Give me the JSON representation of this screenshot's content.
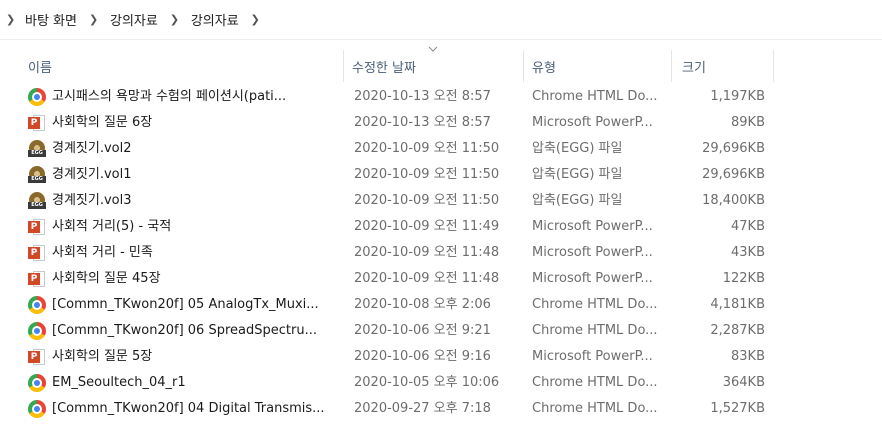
{
  "breadcrumb": {
    "items": [
      "바탕 화면",
      "강의자료",
      "강의자료"
    ]
  },
  "columns": {
    "name": "이름",
    "date": "수정한 날짜",
    "type": "유형",
    "size": "크기"
  },
  "files": [
    {
      "icon": "chrome-icon",
      "name": "고시패스의 욕망과 수험의 페이션시(pati...",
      "date": "2020-10-13 오전 8:57",
      "type": "Chrome HTML Do...",
      "size": "1,197KB"
    },
    {
      "icon": "powerpoint-icon",
      "name": "사회학의 질문 6장",
      "date": "2020-10-13 오전 8:57",
      "type": "Microsoft PowerP...",
      "size": "89KB"
    },
    {
      "icon": "egg-archive-icon",
      "name": "경계짓기.vol2",
      "date": "2020-10-09 오전 11:50",
      "type": "압축(EGG) 파일",
      "size": "29,696KB"
    },
    {
      "icon": "egg-archive-icon",
      "name": "경계짓기.vol1",
      "date": "2020-10-09 오전 11:50",
      "type": "압축(EGG) 파일",
      "size": "29,696KB"
    },
    {
      "icon": "egg-archive-icon",
      "name": "경계짓기.vol3",
      "date": "2020-10-09 오전 11:50",
      "type": "압축(EGG) 파일",
      "size": "18,400KB"
    },
    {
      "icon": "powerpoint-icon",
      "name": "사회적 거리(5) - 국적",
      "date": "2020-10-09 오전 11:49",
      "type": "Microsoft PowerP...",
      "size": "47KB"
    },
    {
      "icon": "powerpoint-icon",
      "name": "사회적 거리 - 민족",
      "date": "2020-10-09 오전 11:48",
      "type": "Microsoft PowerP...",
      "size": "43KB"
    },
    {
      "icon": "powerpoint-icon",
      "name": "사회학의 질문 45장",
      "date": "2020-10-09 오전 11:48",
      "type": "Microsoft PowerP...",
      "size": "122KB"
    },
    {
      "icon": "chrome-icon",
      "name": "[Commn_TKwon20f] 05 AnalogTx_Muxi...",
      "date": "2020-10-08 오후 2:06",
      "type": "Chrome HTML Do...",
      "size": "4,181KB"
    },
    {
      "icon": "chrome-icon",
      "name": "[Commn_TKwon20f] 06 SpreadSpectru...",
      "date": "2020-10-06 오전 9:21",
      "type": "Chrome HTML Do...",
      "size": "2,287KB"
    },
    {
      "icon": "powerpoint-icon",
      "name": "사회학의 질문 5장",
      "date": "2020-10-06 오전 9:16",
      "type": "Microsoft PowerP...",
      "size": "83KB"
    },
    {
      "icon": "chrome-icon",
      "name": "EM_Seoultech_04_r1",
      "date": "2020-10-05 오후 10:06",
      "type": "Chrome HTML Do...",
      "size": "364KB"
    },
    {
      "icon": "chrome-icon",
      "name": "[Commn_TKwon20f] 04 Digital Transmis...",
      "date": "2020-09-27 오후 7:18",
      "type": "Chrome HTML Do...",
      "size": "1,527KB"
    }
  ]
}
